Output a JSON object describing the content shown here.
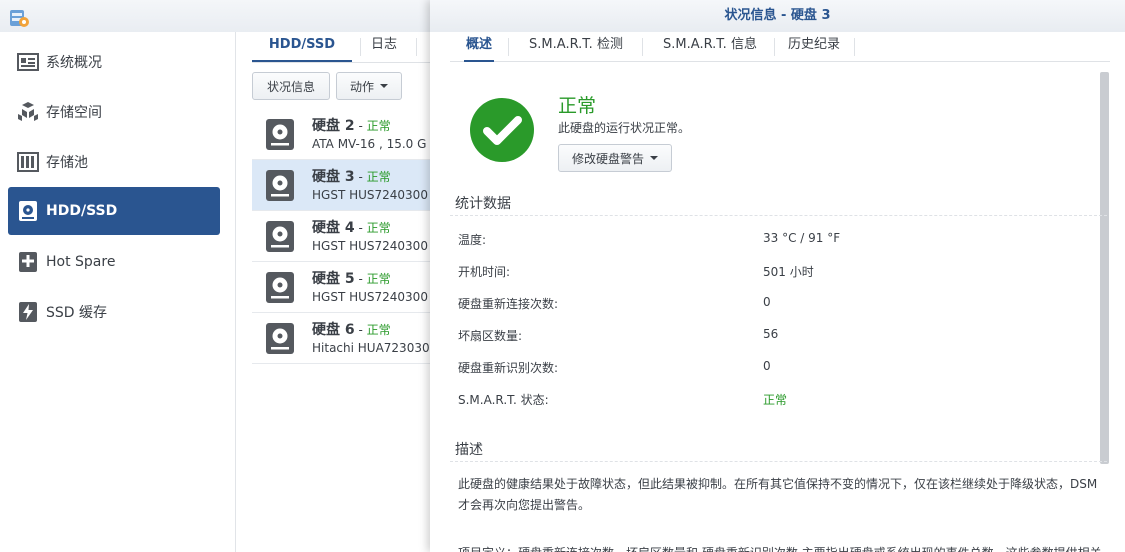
{
  "app": {
    "icon": "storage-manager-icon"
  },
  "sidebar": {
    "items": [
      {
        "label": "系统概况",
        "icon": "overview-icon"
      },
      {
        "label": "存储空间",
        "icon": "volume-icon"
      },
      {
        "label": "存储池",
        "icon": "storage-pool-icon"
      },
      {
        "label": "HDD/SSD",
        "icon": "hdd-icon",
        "active": true
      },
      {
        "label": "Hot Spare",
        "icon": "hot-spare-icon"
      },
      {
        "label": "SSD 缓存",
        "icon": "ssd-cache-icon"
      }
    ]
  },
  "main": {
    "tabs": [
      {
        "label": "HDD/SSD",
        "active": true
      },
      {
        "label": "日志"
      }
    ],
    "toolbar": {
      "status_button": "状况信息",
      "action_button": "动作"
    },
    "disks": [
      {
        "name": "硬盘 2",
        "status": "正常",
        "model": "ATA MV-16 , 15.0 G"
      },
      {
        "name": "硬盘 3",
        "status": "正常",
        "model": "HGST HUS7240300",
        "selected": true
      },
      {
        "name": "硬盘 4",
        "status": "正常",
        "model": "HGST HUS7240300"
      },
      {
        "name": "硬盘 5",
        "status": "正常",
        "model": "HGST HUS7240300"
      },
      {
        "name": "硬盘 6",
        "status": "正常",
        "model": "Hitachi HUA723030"
      }
    ]
  },
  "dialog": {
    "title": "状况信息 - 硬盘 3",
    "tabs": [
      "概述",
      "S.M.A.R.T. 检测",
      "S.M.A.R.T. 信息",
      "历史纪录"
    ],
    "status_title": "正常",
    "status_desc": "此硬盘的运行状况正常。",
    "modify_alert_button": "修改硬盘警告",
    "stats_title": "统计数据",
    "stats": [
      {
        "label": "温度:",
        "value": "33 °C / 91 °F"
      },
      {
        "label": "开机时间:",
        "value": "501 小时"
      },
      {
        "label": "硬盘重新连接次数:",
        "value": "0"
      },
      {
        "label": "坏扇区数量:",
        "value": "56"
      },
      {
        "label": "硬盘重新识别次数:",
        "value": "0"
      },
      {
        "label": "S.M.A.R.T. 状态:",
        "value": "正常"
      }
    ],
    "desc_title": "描述",
    "desc_text": "此硬盘的健康结果处于故障状态，但此结果被抑制。在所有其它值保持不变的情况下，仅在该栏继续处于降级状态，DSM 才会再次向您提出警告。",
    "desc_cut_text": "项目定义：硬盘重新连接次数、坏扇区数量和 硬盘重新识别次数 主要指出硬盘或系统出现的事件总数，这些参数提供相关"
  },
  "colors": {
    "accent": "#2a5590",
    "ok": "#2a9a2a",
    "selected_row": "#dbe8f7"
  }
}
